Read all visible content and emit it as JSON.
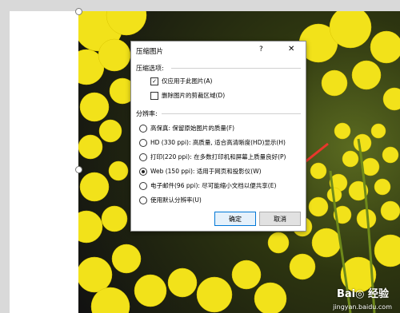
{
  "dialog": {
    "title": "压缩图片",
    "help": "?",
    "close": "✕",
    "compress_section": "压缩选项:",
    "option_apply_only": "仅应用于此图片(A)",
    "option_apply_only_checked": true,
    "option_delete_cropped": "删除图片的剪裁区域(D)",
    "option_delete_cropped_checked": false,
    "resolution_section": "分辨率:",
    "resolutions": [
      {
        "label": "高保真: 保留原始图片的质量(F)",
        "selected": false
      },
      {
        "label": "HD (330 ppi): 高质量, 适合高清晰度(HD)显示(H)",
        "selected": false
      },
      {
        "label": "打印(220 ppi): 在多数打印机和屏幕上质量良好(P)",
        "selected": false
      },
      {
        "label": "Web (150 ppi): 适用于网页和投影仪(W)",
        "selected": true
      },
      {
        "label": "电子邮件(96 ppi): 尽可能缩小文档以便共享(E)",
        "selected": false
      },
      {
        "label": "使用默认分辨率(U)",
        "selected": false
      }
    ],
    "ok_label": "确定",
    "cancel_label": "取消"
  },
  "watermark": {
    "brand": "Bai◎ 经验",
    "url": "jingyan.baidu.com"
  },
  "colors": {
    "arrow": "#e8372c",
    "flower": "#f2e21a",
    "button_primary_border": "#0078d7"
  }
}
